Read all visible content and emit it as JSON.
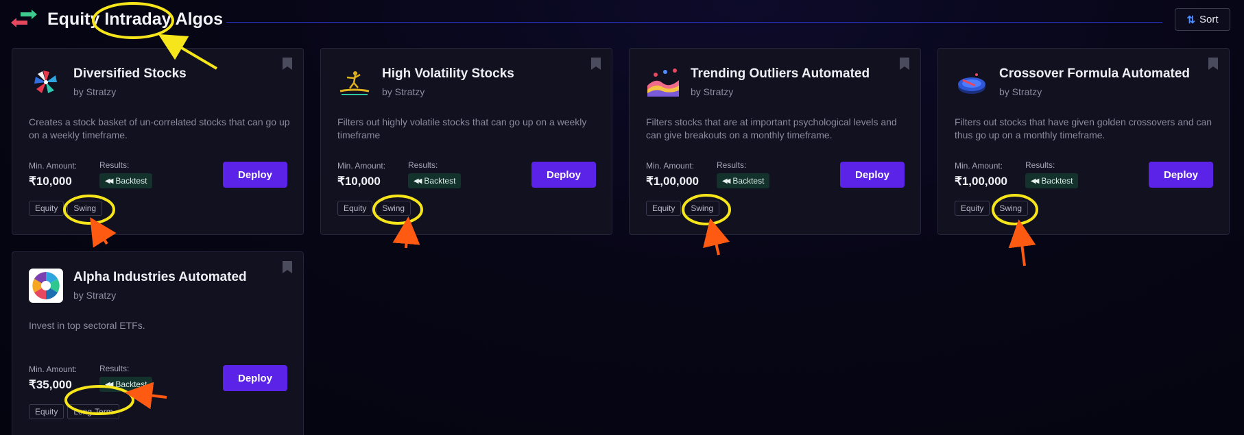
{
  "header": {
    "title": "Equity Intraday Algos",
    "sort_label": "Sort",
    "sort_icon": "sort-arrows-icon",
    "brand_icon": "swap-arrows-icon",
    "accent_color": "#2a34c8"
  },
  "labels": {
    "min_amount": "Min. Amount:",
    "results": "Results:",
    "backtest": "Backtest",
    "deploy": "Deploy"
  },
  "cards": [
    {
      "title": "Diversified Stocks",
      "author": "by Stratzy",
      "description": "Creates a stock basket of un-correlated stocks that can go up on a weekly timeframe.",
      "min_amount": "₹10,000",
      "tags": [
        "Equity",
        "Swing"
      ],
      "logo": "pinwheel-logo"
    },
    {
      "title": "High Volatility Stocks",
      "author": "by Stratzy",
      "description": "Filters out highly volatile stocks that can go up on a weekly timeframe",
      "min_amount": "₹10,000",
      "tags": [
        "Equity",
        "Swing"
      ],
      "logo": "surfer-logo"
    },
    {
      "title": "Trending Outliers Automated",
      "author": "by Stratzy",
      "description": "Filters stocks that are at important psychological levels and can give breakouts on a monthly timeframe.",
      "min_amount": "₹1,00,000",
      "tags": [
        "Equity",
        "Swing"
      ],
      "logo": "waves-logo"
    },
    {
      "title": "Crossover Formula Automated",
      "author": "by Stratzy",
      "description": "Filters out stocks that have given golden crossovers and can thus go up on a monthly timeframe.",
      "min_amount": "₹1,00,000",
      "tags": [
        "Equity",
        "Swing"
      ],
      "logo": "disc-logo"
    },
    {
      "title": "Alpha Industries Automated",
      "author": "by Stratzy",
      "description": "Invest in top sectoral ETFs.",
      "min_amount": "₹35,000",
      "tags": [
        "Equity",
        "Long-Term"
      ],
      "logo": "sector-wheel-logo"
    }
  ],
  "colors": {
    "deploy": "#5b22e8",
    "backtest_bg": "#13322c",
    "annotation_circle": "#f5e51a",
    "annotation_arrow_yellow": "#f5e51a",
    "annotation_arrow_orange": "#ff5a12"
  }
}
